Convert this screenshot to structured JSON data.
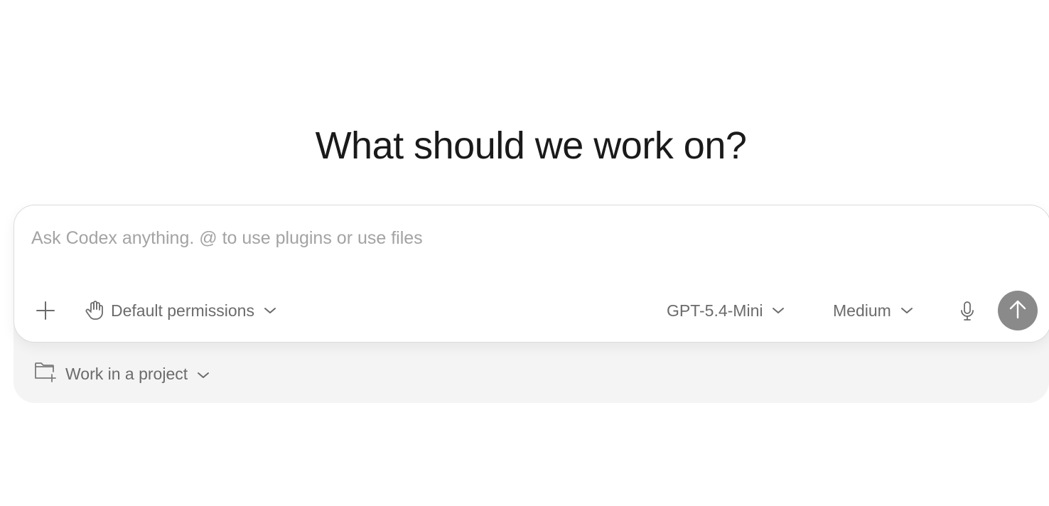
{
  "heading": "What should we work on?",
  "composer": {
    "placeholder": "Ask Codex anything. @ to use plugins or use files",
    "value": "",
    "permissions_label": "Default permissions",
    "model_label": "GPT-5.4-Mini",
    "effort_label": "Medium"
  },
  "project": {
    "label": "Work in a project"
  },
  "icons": {
    "add": "plus-icon",
    "permissions": "hand-icon",
    "mic": "microphone-icon",
    "send": "arrow-up-icon",
    "project": "folder-plus-icon"
  },
  "colors": {
    "send_button": "#8a8a8a",
    "tray": "#f4f4f4",
    "text_muted": "#6b6b6b",
    "placeholder": "#a3a3a3"
  }
}
